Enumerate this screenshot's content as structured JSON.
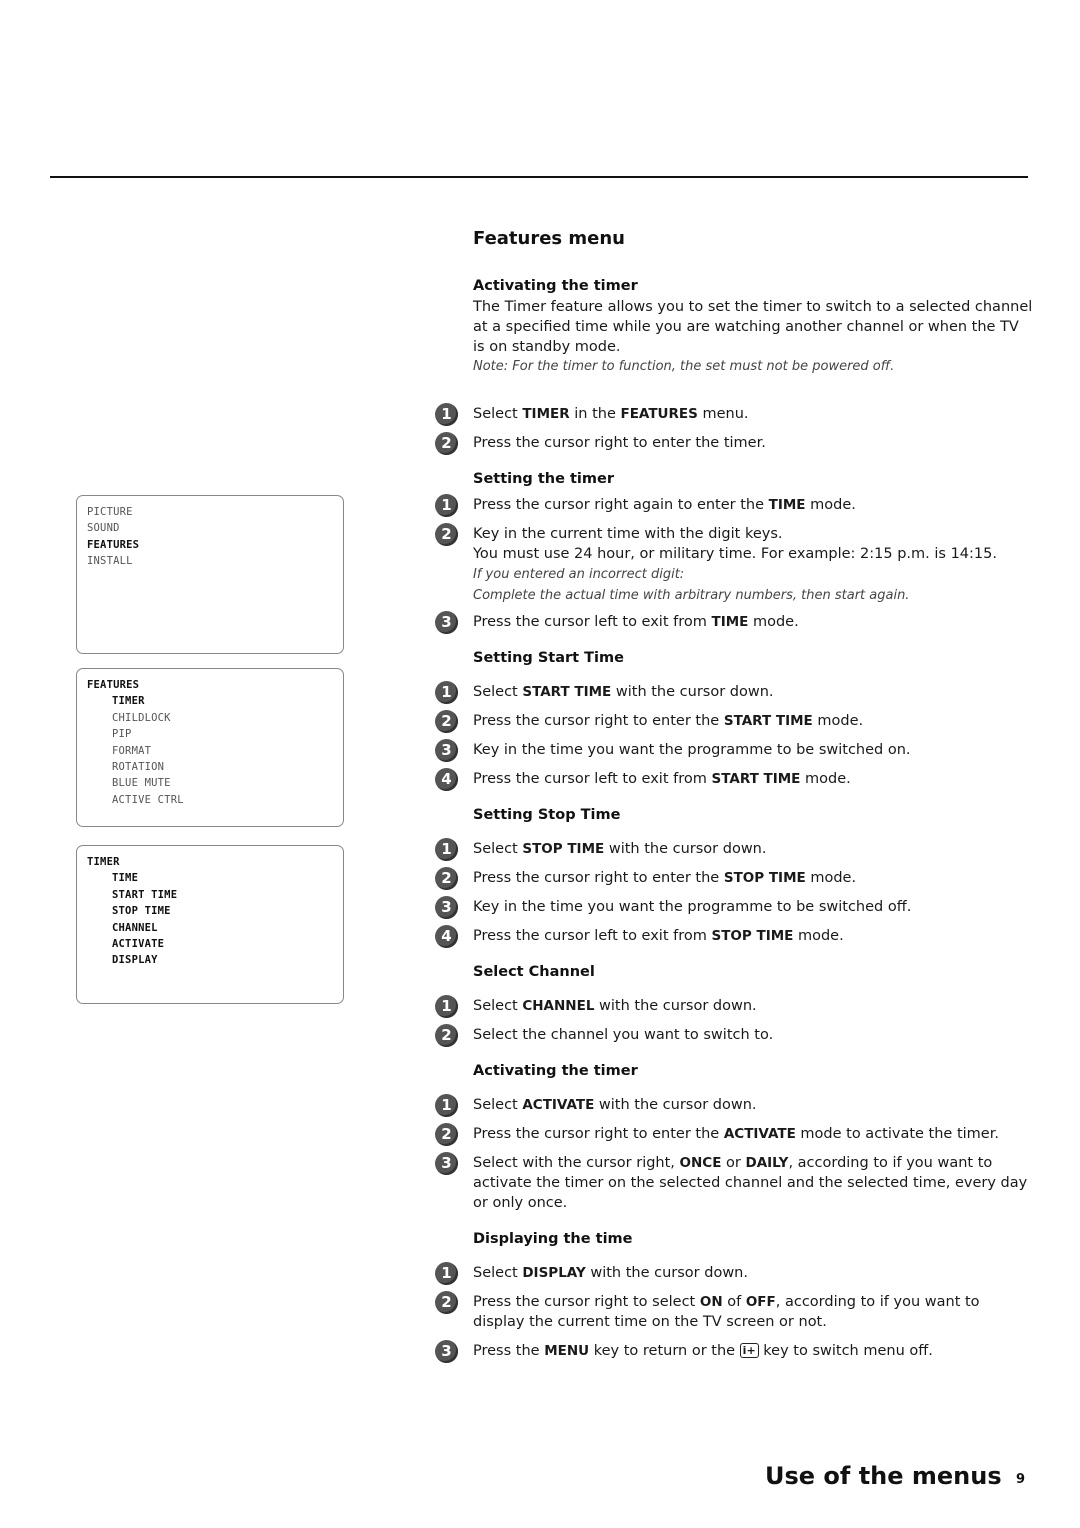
{
  "osd_menus": [
    {
      "rows": [
        {
          "text": "PICTURE",
          "selected": false,
          "indent": false
        },
        {
          "text": "SOUND",
          "selected": false,
          "indent": false
        },
        {
          "text": "FEATURES",
          "selected": true,
          "indent": false
        },
        {
          "text": "INSTALL",
          "selected": false,
          "indent": false
        }
      ]
    },
    {
      "rows": [
        {
          "text": "FEATURES",
          "selected": true,
          "indent": false
        },
        {
          "text": "TIMER",
          "selected": true,
          "indent": true
        },
        {
          "text": "CHILDLOCK",
          "selected": false,
          "indent": true
        },
        {
          "text": "PIP",
          "selected": false,
          "indent": true
        },
        {
          "text": "FORMAT",
          "selected": false,
          "indent": true
        },
        {
          "text": "ROTATION",
          "selected": false,
          "indent": true
        },
        {
          "text": "BLUE MUTE",
          "selected": false,
          "indent": true
        },
        {
          "text": "ACTIVE CTRL",
          "selected": false,
          "indent": true
        }
      ]
    },
    {
      "rows": [
        {
          "text": "TIMER",
          "selected": true,
          "indent": false
        },
        {
          "text": "TIME",
          "selected": true,
          "indent": true
        },
        {
          "text": "START TIME",
          "selected": true,
          "indent": true
        },
        {
          "text": "STOP TIME",
          "selected": true,
          "indent": true
        },
        {
          "text": "CHANNEL",
          "selected": true,
          "indent": true
        },
        {
          "text": "ACTIVATE",
          "selected": true,
          "indent": true
        },
        {
          "text": "DISPLAY",
          "selected": true,
          "indent": true
        }
      ]
    }
  ],
  "section_title": "Features menu",
  "intro": {
    "heading": "Activating the timer",
    "body": "The Timer feature allows you to set the timer to switch to a selected channel at a specified time while you are watching another channel or when the TV is on standby mode.",
    "note": "Note: For the timer to function, the set must not be powered off."
  },
  "intro_steps": [
    {
      "n": "1",
      "html": "Select <b>TIMER</b> in the <b>FEATURES</b> menu."
    },
    {
      "n": "2",
      "html": "Press the cursor right to enter the timer."
    }
  ],
  "sections": [
    {
      "heading": "Setting the timer",
      "steps": [
        {
          "n": "1",
          "html": "Press the cursor right again to enter the <b>TIME</b> mode."
        },
        {
          "n": "2",
          "html": "Key in the current time with the digit keys.<br><span class=\"sub\">You must use 24 hour, or military time. For example: 2:15 p.m. is 14:15.</span><br><span class=\"it\">If you entered an incorrect digit:</span><br><span class=\"it\">Complete the actual time with arbitrary numbers, then start again.</span>"
        },
        {
          "n": "3",
          "html": "Press the cursor left to exit from <b>TIME</b> mode."
        }
      ]
    },
    {
      "heading": "Setting Start Time",
      "steps": [
        {
          "n": "1",
          "html": "Select <b>START TIME</b> with the cursor down."
        },
        {
          "n": "2",
          "html": "Press the cursor right to enter the <b>START TIME</b> mode."
        },
        {
          "n": "3",
          "html": "Key in the time you want the programme to be switched on."
        },
        {
          "n": "4",
          "html": "Press the cursor left to exit from <b>START TIME</b> mode."
        }
      ]
    },
    {
      "heading": "Setting Stop Time",
      "steps": [
        {
          "n": "1",
          "html": "Select <b>STOP TIME</b> with the cursor down."
        },
        {
          "n": "2",
          "html": "Press the cursor right to enter the <b>STOP TIME</b> mode."
        },
        {
          "n": "3",
          "html": "Key in the time you want the programme to be switched off."
        },
        {
          "n": "4",
          "html": "Press the cursor left to exit from <b>STOP TIME</b> mode."
        }
      ]
    },
    {
      "heading": "Select Channel",
      "steps": [
        {
          "n": "1",
          "html": "Select <b>CHANNEL</b> with the cursor down."
        },
        {
          "n": "2",
          "html": "Select the channel you want to switch to."
        }
      ]
    },
    {
      "heading": "Activating the timer",
      "steps": [
        {
          "n": "1",
          "html": "Select <b>ACTIVATE</b> with the cursor down."
        },
        {
          "n": "2",
          "html": "Press the cursor right to enter the <b>ACTIVATE</b> mode to activate the timer."
        },
        {
          "n": "3",
          "html": "Select with the cursor right, <b>ONCE</b> or <b>DAILY</b>, according to if you want to activate the timer on the selected channel and the selected time, every day or only once."
        }
      ]
    },
    {
      "heading": "Displaying the time",
      "steps": [
        {
          "n": "1",
          "html": "Select <b>DISPLAY</b> with the cursor down."
        },
        {
          "n": "2",
          "html": "Press the cursor right to select <b>ON</b> of <b>OFF</b>, according to if you want to display the current time on the TV screen or not."
        },
        {
          "n": "3",
          "html": "Press the <b>MENU</b> key to return or the <span class=\"key-icon\" data-name=\"info-plus-key-icon\" data-interactable=\"false\">i+</span> key to switch menu off."
        }
      ]
    }
  ],
  "footer": {
    "title": "Use of the menus",
    "page_number": "9"
  }
}
